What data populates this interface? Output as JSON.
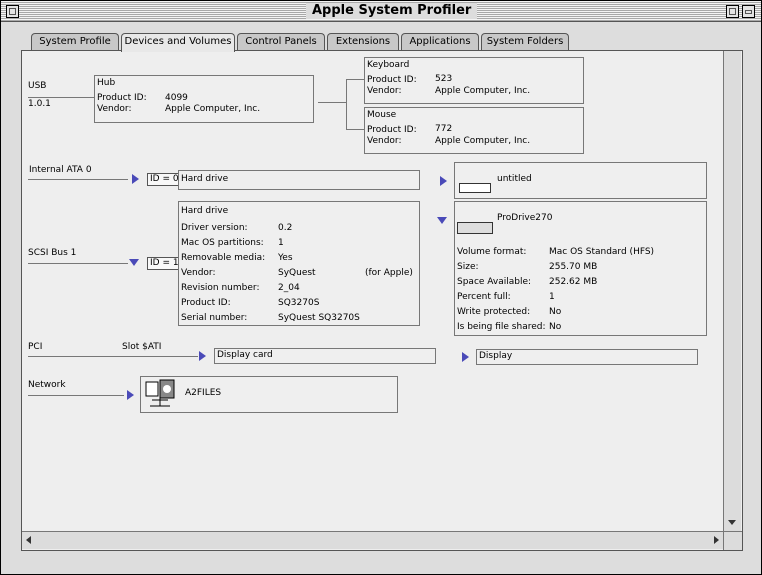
{
  "window": {
    "title": "Apple System Profiler"
  },
  "tabs": [
    {
      "label": "System Profile"
    },
    {
      "label": "Devices and Volumes"
    },
    {
      "label": "Control Panels"
    },
    {
      "label": "Extensions"
    },
    {
      "label": "Applications"
    },
    {
      "label": "System Folders"
    }
  ],
  "active_tab": "Devices and Volumes",
  "usb": {
    "label": "USB",
    "version": "1.0.1",
    "hub": {
      "title": "Hub",
      "product_id_label": "Product ID:",
      "product_id": "4099",
      "vendor_label": "Vendor:",
      "vendor": "Apple Computer, Inc."
    },
    "keyboard": {
      "title": "Keyboard",
      "product_id_label": "Product ID:",
      "product_id": "523",
      "vendor_label": "Vendor:",
      "vendor": "Apple Computer, Inc."
    },
    "mouse": {
      "title": "Mouse",
      "product_id_label": "Product ID:",
      "product_id": "772",
      "vendor_label": "Vendor:",
      "vendor": "Apple Computer, Inc."
    }
  },
  "ata": {
    "label": "Internal ATA 0",
    "id": "ID = 0",
    "device": "Hard drive",
    "volume": "untitled"
  },
  "scsi": {
    "label": "SCSI Bus 1",
    "id": "ID = 1",
    "device": {
      "title": "Hard drive",
      "rows": [
        {
          "label": "Driver version:",
          "value": "0.2"
        },
        {
          "label": "Mac OS partitions:",
          "value": "1"
        },
        {
          "label": "Removable media:",
          "value": "Yes"
        },
        {
          "label": "Vendor:",
          "value": "SyQuest",
          "extra": "(for Apple)"
        },
        {
          "label": "Revision number:",
          "value": "2_04"
        },
        {
          "label": "Product ID:",
          "value": "SQ3270S"
        },
        {
          "label": "Serial number:",
          "value": "SyQuest SQ3270S"
        }
      ]
    },
    "volume": {
      "title": "ProDrive270",
      "rows": [
        {
          "label": "Volume format:",
          "value": "Mac OS Standard (HFS)"
        },
        {
          "label": "Size:",
          "value": "255.70 MB"
        },
        {
          "label": "Space Available:",
          "value": "252.62 MB"
        },
        {
          "label": "Percent full:",
          "value": "1"
        },
        {
          "label": "Write protected:",
          "value": "No"
        },
        {
          "label": "Is being file shared:",
          "value": "No"
        }
      ]
    }
  },
  "pci": {
    "label": "PCI",
    "slot": "Slot $ATI",
    "card": "Display card",
    "display": "Display"
  },
  "network": {
    "label": "Network",
    "server": "A2FILES"
  },
  "colors": {
    "accent_triangle": "#4a4ab8",
    "panel_bg": "#eeeeee",
    "window_bg": "#dddddd"
  }
}
